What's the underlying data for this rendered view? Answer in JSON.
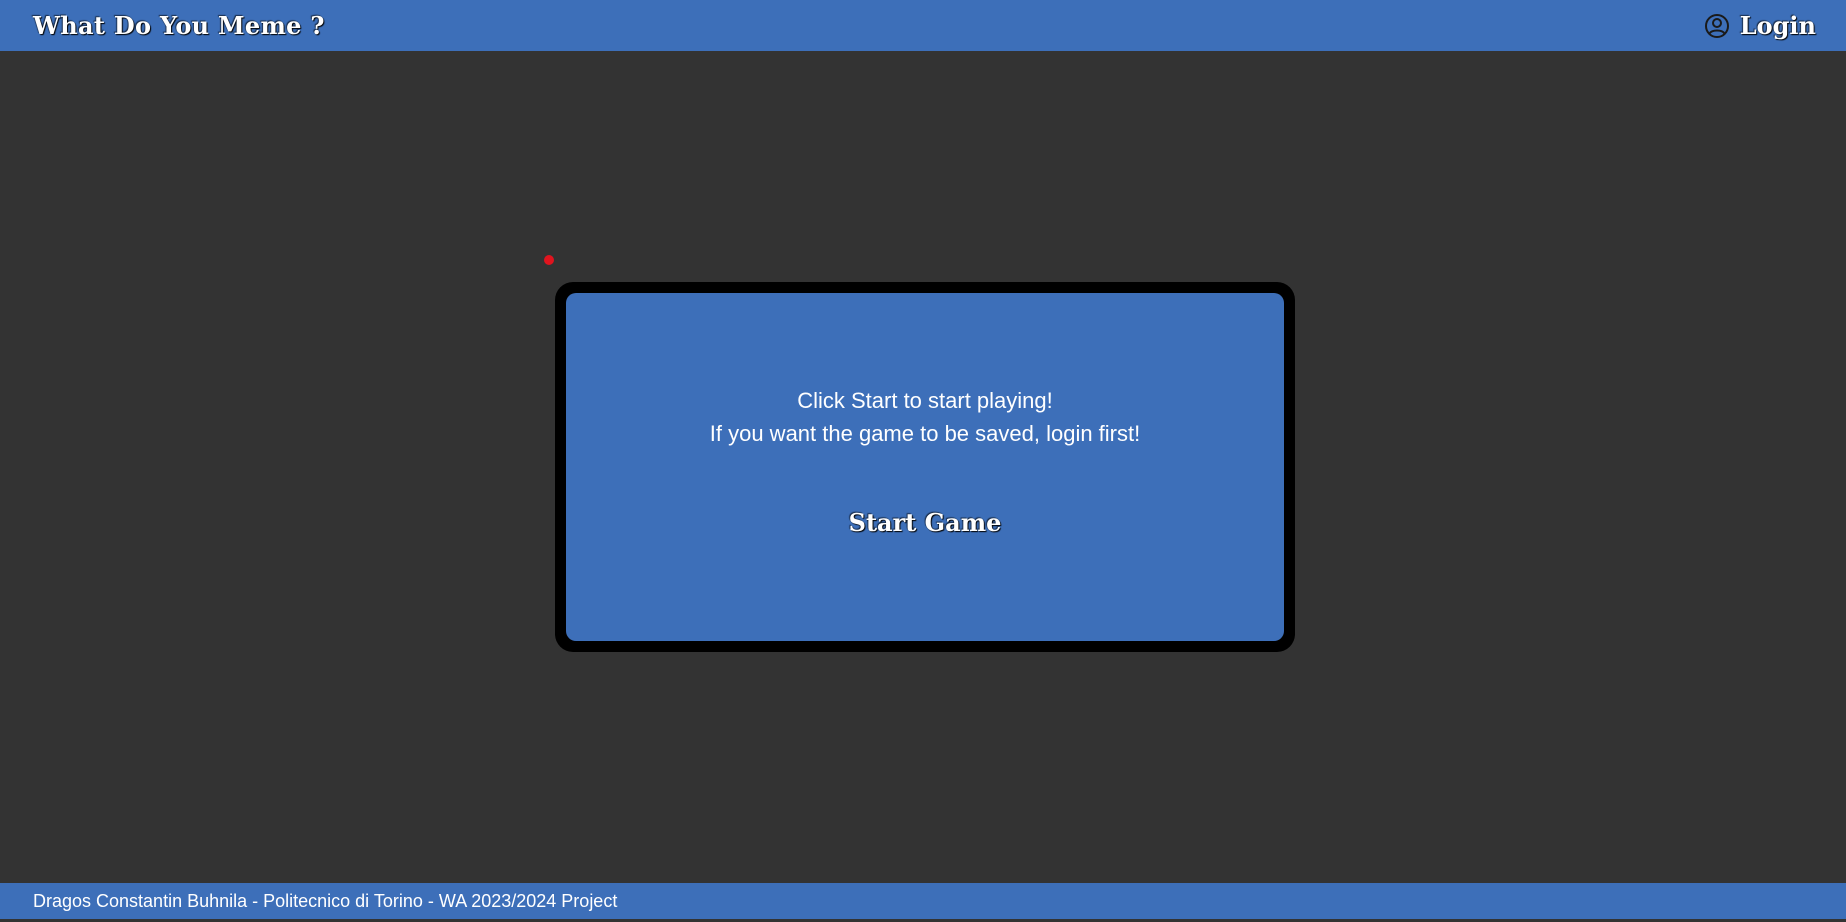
{
  "header": {
    "title": "What Do You Meme ?",
    "login_label": "Login",
    "login_icon": "user-circle-icon"
  },
  "main": {
    "message_line1": "Click Start to start playing!",
    "message_line2": "If you want the game to be saved, login first!",
    "start_button_label": "Start Game"
  },
  "footer": {
    "text": "Dragos Constantin Buhnila - Politecnico di Torino - WA 2023/2024 Project"
  },
  "colors": {
    "primary": "#3d6fb9",
    "background": "#333333",
    "card_border": "#000000",
    "indicator_dot": "#e0141e"
  }
}
